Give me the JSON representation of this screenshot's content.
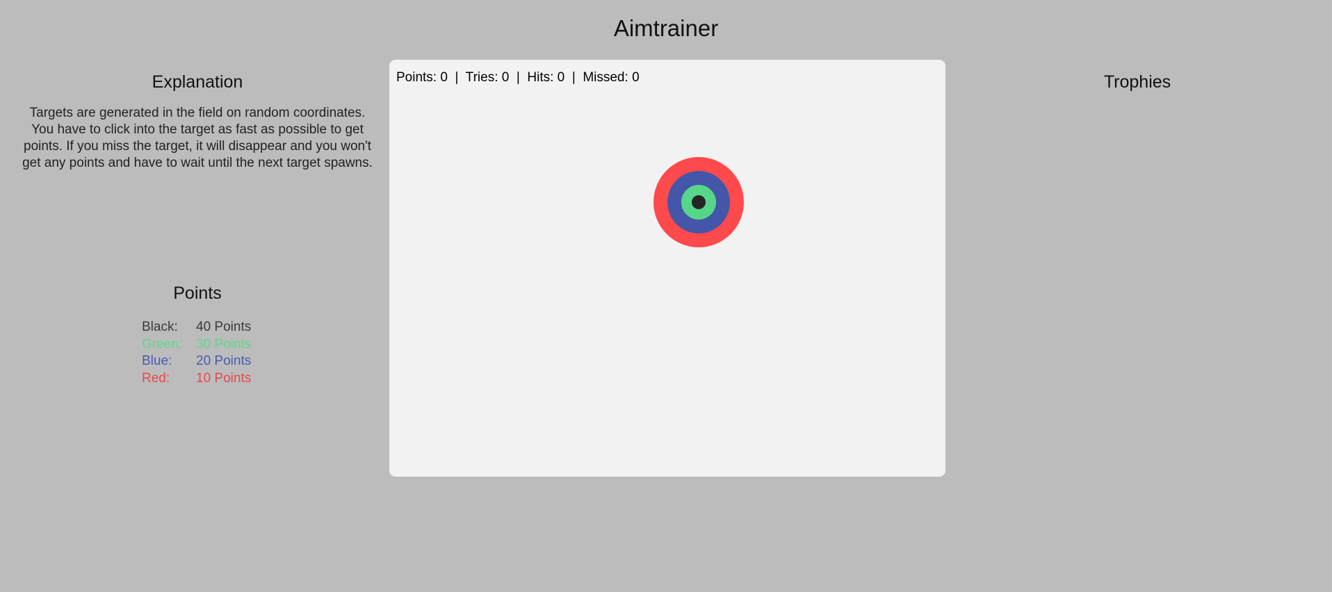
{
  "app": {
    "title": "Aimtrainer"
  },
  "explanation": {
    "title": "Explanation",
    "text": "Targets are generated in the field on random coordinates. You have to click into the target as fast as possible to get points. If you miss the target, it will disappear and you won't get any points and have to wait until the next target spawns."
  },
  "points": {
    "title": "Points",
    "rows": [
      {
        "label": "Black:",
        "value": "40 Points",
        "color": "#3a3a3a"
      },
      {
        "label": "Green:",
        "value": "30 Points",
        "color": "#5ed88e"
      },
      {
        "label": "Blue:",
        "value": "20 Points",
        "color": "#4a5ab0"
      },
      {
        "label": "Red:",
        "value": "10 Points",
        "color": "#e8484b"
      }
    ]
  },
  "stats": {
    "points_label": "Points:",
    "points": "0",
    "tries_label": "Tries:",
    "tries": "0",
    "hits_label": "Hits:",
    "hits": "0",
    "missed_label": "Missed:",
    "missed": "0",
    "separator": "|"
  },
  "target": {
    "rings": [
      {
        "name": "red",
        "color": "#ff4a4d"
      },
      {
        "name": "blue",
        "color": "#4456a8"
      },
      {
        "name": "green",
        "color": "#57d68a"
      },
      {
        "name": "black",
        "color": "#252525"
      }
    ]
  },
  "trophies": {
    "title": "Trophies"
  }
}
